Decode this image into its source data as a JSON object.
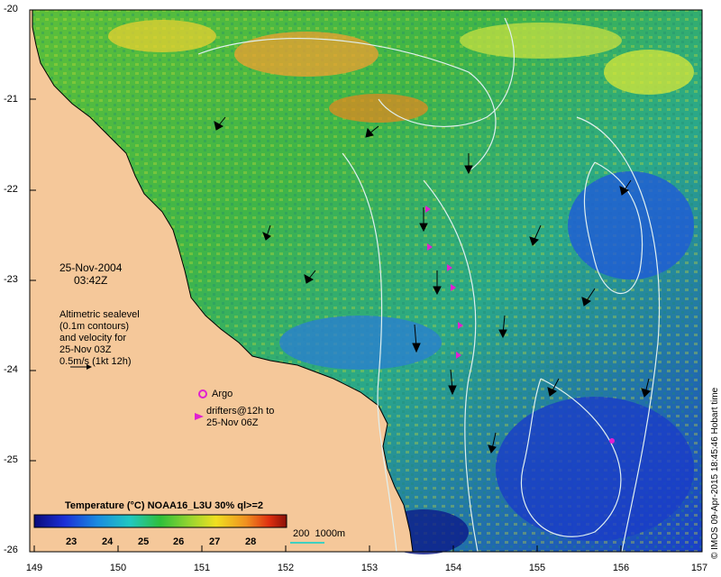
{
  "map": {
    "date": "25-Nov-2004",
    "time": "03:42Z",
    "altimetry_lines": [
      "Altimetric sealevel",
      "(0.1m contours)",
      "and velocity for",
      "25-Nov 03Z",
      "0.5m/s (1kt 12h)"
    ],
    "argo_label": "Argo",
    "drifter_lines": [
      "drifters@12h to",
      "25-Nov 06Z"
    ],
    "colorbar_title": "Temperature (°C) NOAA16_L3U 30% ql>=2",
    "colorbar_ticks": [
      "23",
      "24",
      "25",
      "26",
      "27",
      "28"
    ],
    "depth_label": "200  1000m",
    "credit": "© IMOS 09-Apr-2015 18:45:46 Hobart time",
    "lat_ticks": [
      "-20",
      "-21",
      "-22",
      "-23",
      "-24",
      "-25",
      "-26"
    ],
    "lon_ticks": [
      "149",
      "150",
      "151",
      "152",
      "153",
      "154",
      "155",
      "156",
      "157"
    ],
    "colors": {
      "land": "#f5c89a",
      "magenta": "#e020d0",
      "contour": "#e0f0f0"
    }
  }
}
